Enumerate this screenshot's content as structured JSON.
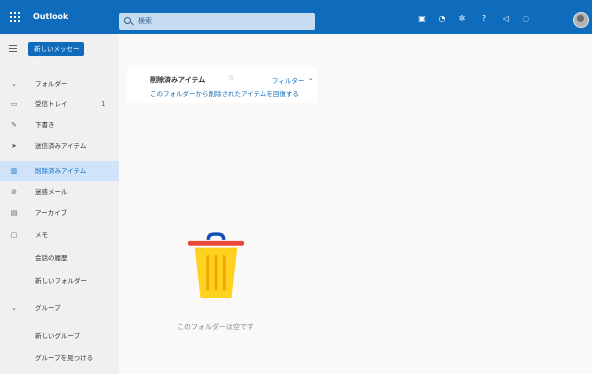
{
  "app": {
    "title": "Outlook"
  },
  "search": {
    "placeholder": "検索"
  },
  "toolbar": {
    "new_mail_label": "新しいメッセージ"
  },
  "sidebar": {
    "items": [
      {
        "label": "フォルダー",
        "icon": "chevron-down-icon"
      },
      {
        "label": "受信トレイ",
        "icon": "inbox-icon",
        "count": "1"
      },
      {
        "label": "下書き",
        "icon": "pencil-icon"
      },
      {
        "label": "送信済みアイテム",
        "icon": "send-icon"
      },
      {
        "label": "削除済みアイテム",
        "icon": "trash-icon",
        "active": true
      },
      {
        "label": "迷惑メール",
        "icon": "junk-icon"
      },
      {
        "label": "アーカイブ",
        "icon": "archive-icon"
      },
      {
        "label": "メモ",
        "icon": "note-icon"
      },
      {
        "label": "会話の履歴",
        "icon": ""
      },
      {
        "label": "新しいフォルダー",
        "icon": ""
      },
      {
        "label": "グループ",
        "icon": "chevron-down-icon"
      },
      {
        "label": "新しいグループ",
        "icon": ""
      },
      {
        "label": "グループを見つける",
        "icon": ""
      }
    ]
  },
  "folder": {
    "title": "削除済みアイテム",
    "filter_label": "フィルター",
    "recover_link": "このフォルダーから削除されたアイテムを回復する"
  },
  "empty_state": {
    "message": "このフォルダーは空です"
  },
  "colors": {
    "accent": "#0f6cbd",
    "active_bg": "#cfe4fa",
    "trash_body": "#ffd21f",
    "trash_lid": "#e8493c"
  }
}
